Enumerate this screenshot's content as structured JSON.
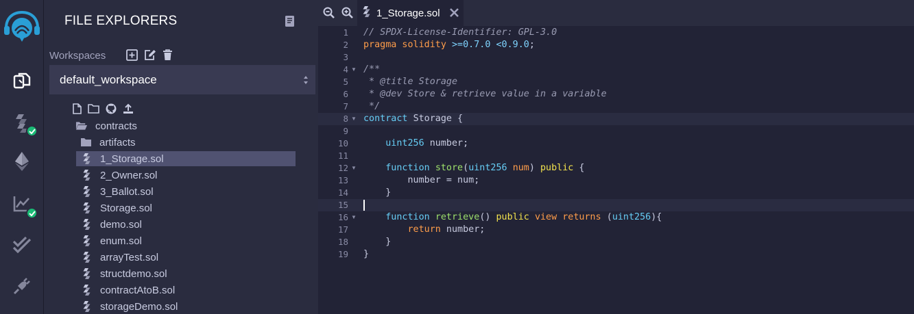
{
  "sidebar_panel": {
    "title": "FILE EXPLORERS",
    "workspaces_label": "Workspaces",
    "workspace_selected": "default_workspace"
  },
  "tree": {
    "folder_contracts": "contracts",
    "folder_artifacts": "artifacts",
    "files": [
      "1_Storage.sol",
      "2_Owner.sol",
      "3_Ballot.sol",
      "Storage.sol",
      "demo.sol",
      "enum.sol",
      "arrayTest.sol",
      "structdemo.sol",
      "contractAtoB.sol",
      "storageDemo.sol"
    ],
    "selected_file": "1_Storage.sol"
  },
  "editor": {
    "tab_label": "1_Storage.sol",
    "active_line": 15,
    "lines": [
      [
        [
          "// SPDX-License-Identifier: GPL-3.0",
          "com"
        ]
      ],
      [
        [
          "pragma solidity ",
          "kw"
        ],
        [
          ">=0.7.0 <0.9.0",
          "num"
        ],
        [
          ";",
          "id"
        ]
      ],
      [],
      [
        [
          "/**",
          "com"
        ]
      ],
      [
        [
          " * @title Storage",
          "com"
        ]
      ],
      [
        [
          " * @dev Store & retrieve value in a variable",
          "com"
        ]
      ],
      [
        [
          " */",
          "com"
        ]
      ],
      [
        [
          "contract ",
          "ctr"
        ],
        [
          "Storage",
          "id"
        ],
        [
          " {",
          "id"
        ]
      ],
      [],
      [
        [
          "    ",
          "id"
        ],
        [
          "uint256",
          "type"
        ],
        [
          " number;",
          "id"
        ]
      ],
      [],
      [
        [
          "    ",
          "id"
        ],
        [
          "function ",
          "ctr"
        ],
        [
          "store",
          "fn"
        ],
        [
          "(",
          "id"
        ],
        [
          "uint256",
          "type"
        ],
        [
          " ",
          "id"
        ],
        [
          "num",
          "kw"
        ],
        [
          ") ",
          "id"
        ],
        [
          "public",
          "mod"
        ],
        [
          " {",
          "id"
        ]
      ],
      [
        [
          "        number = num;",
          "id"
        ]
      ],
      [
        [
          "    }",
          "id"
        ]
      ],
      [],
      [
        [
          "    ",
          "id"
        ],
        [
          "function ",
          "ctr"
        ],
        [
          "retrieve",
          "fn"
        ],
        [
          "() ",
          "id"
        ],
        [
          "public",
          "mod"
        ],
        [
          " ",
          "id"
        ],
        [
          "view",
          "kw"
        ],
        [
          " ",
          "id"
        ],
        [
          "returns",
          "ret"
        ],
        [
          " (",
          "id"
        ],
        [
          "uint256",
          "type"
        ],
        [
          "){",
          "id"
        ]
      ],
      [
        [
          "        ",
          "id"
        ],
        [
          "return",
          "ret"
        ],
        [
          " number;",
          "id"
        ]
      ],
      [
        [
          "    }",
          "id"
        ]
      ],
      [
        [
          "}",
          "id"
        ]
      ]
    ],
    "fold_lines": [
      4,
      8,
      12,
      16
    ]
  },
  "colors": {
    "rail_bg": "#2a2c3f",
    "editor_bg": "#222336",
    "selected_row": "#505271",
    "badge_green": "#1aba75",
    "logo_blue": "#2a9fd6"
  },
  "icons": {
    "rail": [
      "remix-logo-icon",
      "file-explorer-icon",
      "solidity-compiler-icon",
      "deploy-run-icon",
      "analysis-icon",
      "unit-test-icon",
      "plugin-manager-icon"
    ],
    "workspace_actions": [
      "add-workspace-icon",
      "rename-workspace-icon",
      "delete-workspace-icon"
    ],
    "tree_toolbar": [
      "new-file-icon",
      "new-folder-icon",
      "github-icon",
      "upload-icon"
    ]
  }
}
